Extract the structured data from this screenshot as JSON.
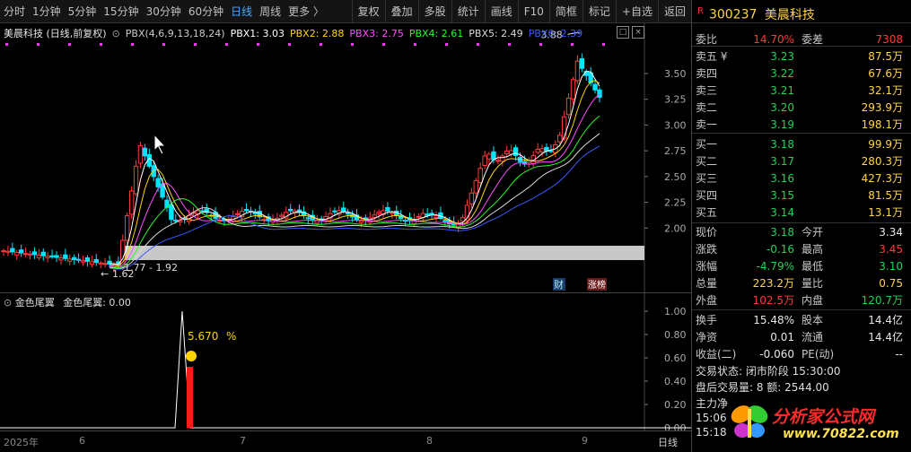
{
  "toolbar": {
    "periods": [
      "分时",
      "1分钟",
      "5分钟",
      "15分钟",
      "30分钟",
      "60分钟",
      "日线",
      "周线",
      "更多 〉"
    ],
    "active_period": "日线",
    "actions": [
      "复权",
      "叠加",
      "多股",
      "统计",
      "画线",
      "F10",
      "简框",
      "标记",
      "+自选",
      "返回"
    ]
  },
  "main_legend": {
    "stock": "美晨科技 (日线,前复权)",
    "indicator": "PBX(4,6,9,13,18,24)",
    "pbx1": "PBX1: 3.03",
    "pbx2": "PBX2: 2.88",
    "pbx3": "PBX3: 2.75",
    "pbx4": "PBX4: 2.61",
    "pbx5": "PBX5: 2.49",
    "pbx6": "PBX6: 2.39"
  },
  "colors": {
    "up": "#ff3b3b",
    "down": "#00e5ff",
    "pbx1": "#ffffff",
    "pbx2": "#ffd400",
    "pbx3": "#ff4dff",
    "pbx4": "#22ff22",
    "pbx5": "#d9d9d9",
    "pbx6": "#3b5bff"
  },
  "main_axis": {
    "ticks": [
      "3.50",
      "3.25",
      "3.00",
      "2.75",
      "2.50",
      "2.25",
      "2.00"
    ]
  },
  "annotations": {
    "high": "3.88",
    "low": "1.62",
    "range": "1.77 - 1.92",
    "badge_cai": "财",
    "badge_zt": "涨榜"
  },
  "sub_legend": {
    "name": "金色尾翼",
    "value": "金色尾翼: 0.00"
  },
  "sub_axis": {
    "ticks": [
      "1.00",
      "0.80",
      "0.60",
      "0.40",
      "0.20",
      "0.00"
    ]
  },
  "sub_annotation": {
    "value": "5.670",
    "unit": "%"
  },
  "date_axis": {
    "labels": [
      "2025年",
      "6",
      "7",
      "8",
      "9"
    ],
    "right_label": "日线"
  },
  "watermark": "www.70822.com 分析家公式网www.70822.com 分析家公式网",
  "quote": {
    "code": "300237",
    "name": "美晨科技",
    "weibi_label": "委比",
    "weibi": "14.70%",
    "weicha_label": "委差",
    "weicha": "7308",
    "asks": [
      {
        "label": "卖五 ¥",
        "price": "3.23",
        "vol": "87.5万"
      },
      {
        "label": "卖四",
        "price": "3.22",
        "vol": "67.6万"
      },
      {
        "label": "卖三",
        "price": "3.21",
        "vol": "32.1万"
      },
      {
        "label": "卖二",
        "price": "3.20",
        "vol": "293.9万"
      },
      {
        "label": "卖一",
        "price": "3.19",
        "vol": "198.1万"
      }
    ],
    "bids": [
      {
        "label": "买一",
        "price": "3.18",
        "vol": "99.9万"
      },
      {
        "label": "买二",
        "price": "3.17",
        "vol": "280.3万"
      },
      {
        "label": "买三",
        "price": "3.16",
        "vol": "427.3万"
      },
      {
        "label": "买四",
        "price": "3.15",
        "vol": "81.5万"
      },
      {
        "label": "买五",
        "price": "3.14",
        "vol": "13.1万"
      }
    ],
    "stats": [
      {
        "l": "现价",
        "v": "3.18",
        "c": "green",
        "l2": "今开",
        "v2": "3.34",
        "c2": "white"
      },
      {
        "l": "涨跌",
        "v": "-0.16",
        "c": "green",
        "l2": "最高",
        "v2": "3.45",
        "c2": "red"
      },
      {
        "l": "涨幅",
        "v": "-4.79%",
        "c": "green",
        "l2": "最低",
        "v2": "3.10",
        "c2": "green"
      },
      {
        "l": "总量",
        "v": "223.2万",
        "c": "yellow",
        "l2": "量比",
        "v2": "0.75",
        "c2": "yellow"
      },
      {
        "l": "外盘",
        "v": "102.5万",
        "c": "red",
        "l2": "内盘",
        "v2": "120.7万",
        "c2": "green"
      }
    ],
    "stats2": [
      {
        "l": "换手",
        "v": "15.48%",
        "l2": "股本",
        "v2": "14.4亿"
      },
      {
        "l": "净资",
        "v": "0.01",
        "l2": "流通",
        "v2": "14.4亿"
      },
      {
        "l": "收益(二)",
        "v": "-0.060",
        "l2": "PE(动)",
        "v2": "--"
      }
    ],
    "trade_status": "交易状态: 闭市阶段 15:30:00",
    "after_hours": "盘后交易量: 8  额: 2544.00",
    "main_force": "主力净",
    "time1": "15:06",
    "time2": "15:18"
  },
  "logo": {
    "line1": "分析家公式网",
    "line2": "www.70822.com"
  }
}
